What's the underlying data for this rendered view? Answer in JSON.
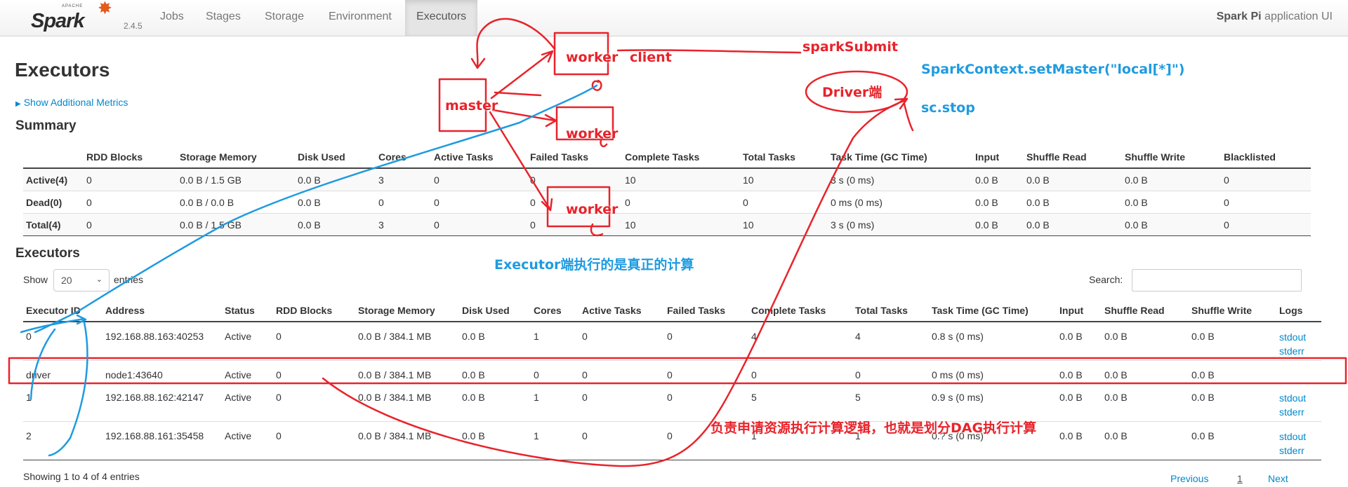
{
  "nav": {
    "logo_word": "Spark",
    "logo_apache": "APACHE",
    "version": "2.4.5",
    "tabs": [
      "Jobs",
      "Stages",
      "Storage",
      "Environment",
      "Executors"
    ],
    "active_tab": "Executors",
    "app_name": "Spark Pi",
    "app_suffix": "application UI"
  },
  "page": {
    "title": "Executors",
    "additional_metrics": "Show Additional Metrics"
  },
  "summary": {
    "title": "Summary",
    "columns": [
      "",
      "RDD Blocks",
      "Storage Memory",
      "Disk Used",
      "Cores",
      "Active Tasks",
      "Failed Tasks",
      "Complete Tasks",
      "Total Tasks",
      "Task Time (GC Time)",
      "Input",
      "Shuffle Read",
      "Shuffle Write",
      "Blacklisted"
    ],
    "rows": [
      [
        "Active(4)",
        "0",
        "0.0 B / 1.5 GB",
        "0.0 B",
        "3",
        "0",
        "0",
        "10",
        "10",
        "3 s (0 ms)",
        "0.0 B",
        "0.0 B",
        "0.0 B",
        "0"
      ],
      [
        "Dead(0)",
        "0",
        "0.0 B / 0.0 B",
        "0.0 B",
        "0",
        "0",
        "0",
        "0",
        "0",
        "0 ms (0 ms)",
        "0.0 B",
        "0.0 B",
        "0.0 B",
        "0"
      ],
      [
        "Total(4)",
        "0",
        "0.0 B / 1.5 GB",
        "0.0 B",
        "3",
        "0",
        "0",
        "10",
        "10",
        "3 s (0 ms)",
        "0.0 B",
        "0.0 B",
        "0.0 B",
        "0"
      ]
    ]
  },
  "executors": {
    "title": "Executors",
    "show_label": "Show",
    "page_size": "20",
    "entries_label": "entries",
    "search_label": "Search:",
    "search_value": "",
    "columns": [
      "Executor ID",
      "Address",
      "Status",
      "RDD Blocks",
      "Storage Memory",
      "Disk Used",
      "Cores",
      "Active Tasks",
      "Failed Tasks",
      "Complete Tasks",
      "Total Tasks",
      "Task Time (GC Time)",
      "Input",
      "Shuffle Read",
      "Shuffle Write",
      "Logs"
    ],
    "rows": [
      [
        "0",
        "192.168.88.163:40253",
        "Active",
        "0",
        "0.0 B / 384.1 MB",
        "0.0 B",
        "1",
        "0",
        "0",
        "4",
        "4",
        "0.8 s (0 ms)",
        "0.0 B",
        "0.0 B",
        "0.0 B",
        [
          "stdout",
          "stderr"
        ]
      ],
      [
        "driver",
        "node1:43640",
        "Active",
        "0",
        "0.0 B / 384.1 MB",
        "0.0 B",
        "0",
        "0",
        "0",
        "0",
        "0",
        "0 ms (0 ms)",
        "0.0 B",
        "0.0 B",
        "0.0 B",
        []
      ],
      [
        "1",
        "192.168.88.162:42147",
        "Active",
        "0",
        "0.0 B / 384.1 MB",
        "0.0 B",
        "1",
        "0",
        "0",
        "5",
        "5",
        "0.9 s (0 ms)",
        "0.0 B",
        "0.0 B",
        "0.0 B",
        [
          "stdout",
          "stderr"
        ]
      ],
      [
        "2",
        "192.168.88.161:35458",
        "Active",
        "0",
        "0.0 B / 384.1 MB",
        "0.0 B",
        "1",
        "0",
        "0",
        "1",
        "1",
        "0.? s (0 ms)",
        "0.0 B",
        "0.0 B",
        "0.0 B",
        [
          "stdout",
          "stderr"
        ]
      ]
    ],
    "footer": "Showing 1 to 4 of 4 entries",
    "pagination": {
      "previous": "Previous",
      "current": "1",
      "next": "Next"
    }
  },
  "annotations": {
    "master": "master",
    "worker": "worker",
    "client": "client",
    "spark_submit": "sparkSubmit",
    "driver_side": "Driver端",
    "set_master": "SparkContext.setMaster(\"local[*]\")",
    "sc_stop": "sc.stop",
    "executor_note": "Executor端执行的是真正的计算",
    "driver_note": "负责申请资源执行计算逻辑，也就是划分DAG执行计算",
    "colors": {
      "red": "#e8232b",
      "blue": "#1e9be0"
    }
  },
  "colors": {
    "link": "#0088cc",
    "text": "#333333",
    "spark_orange": "#e25a1c"
  }
}
